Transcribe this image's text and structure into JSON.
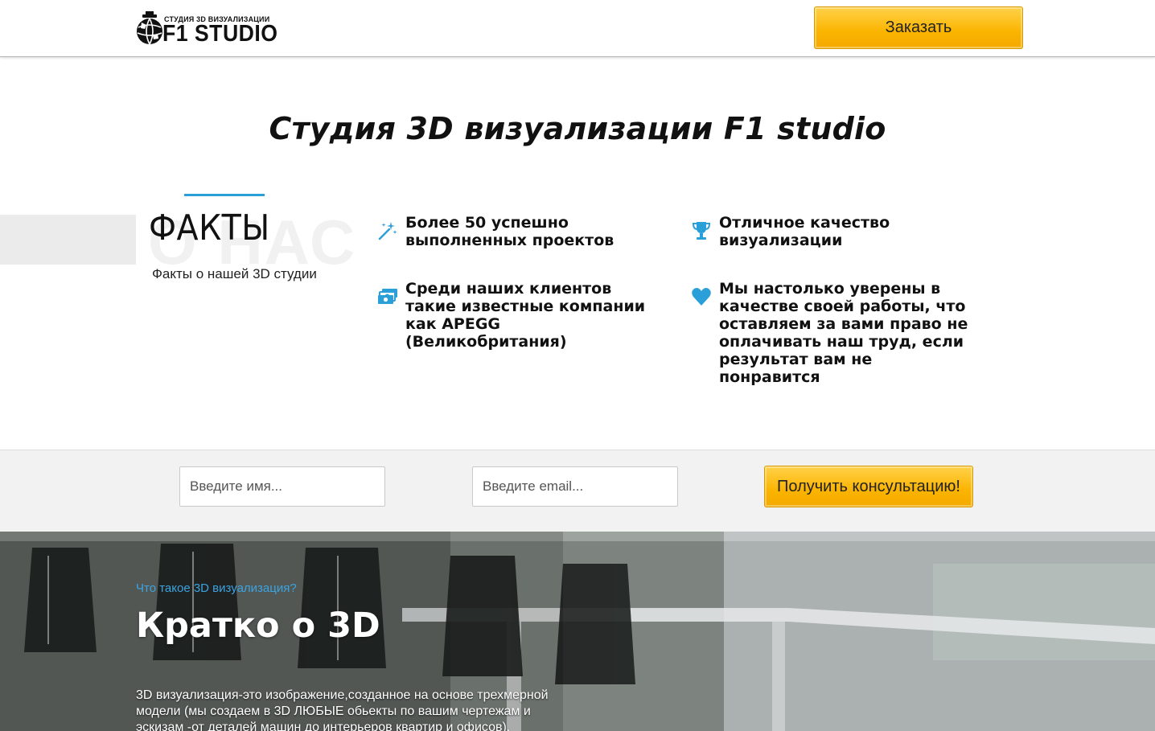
{
  "header": {
    "logo_subtitle": "СТУДИЯ 3D ВИЗУАЛИЗАЦИИ",
    "logo_title": "F1 STUDIO",
    "order_button": "Заказать"
  },
  "main": {
    "title": "Студия 3D визуализации F1 studio"
  },
  "facts": {
    "ghost_text": "О НАС",
    "heading": "ФАКТЫ",
    "subheading": "Факты о нашей 3D студии",
    "items": [
      {
        "icon": "magic-wand-icon",
        "text": "Более 50 успешно выполненных проектов"
      },
      {
        "icon": "trophy-icon",
        "text": "Отличное качество визуализации"
      },
      {
        "icon": "money-icon",
        "text": "Среди наших клиентов такие известные компании как APEGG (Великобритания)"
      },
      {
        "icon": "heart-icon",
        "text": "Мы настолько уверены в качестве своей работы, что оставляем за вами право не оплачивать наш труд, если результат вам не понравится"
      }
    ],
    "accent_color": "#2a9fd8"
  },
  "form": {
    "name_placeholder": "Введите имя...",
    "email_placeholder": "Введите email...",
    "submit_button": "Получить консультацию!"
  },
  "about": {
    "link": "Что такое 3D визуализация?",
    "title": "Кратко о 3D",
    "text": "3D визуализация-это изображение,созданное на основе трехмерной модели (мы создаем в 3D ЛЮБЫЕ обьекты по вашим чертежам и эскизам -от деталей машин до интерьеров квартир и офисов)."
  },
  "colors": {
    "button_yellow": "#fbb400",
    "link_blue": "#3ba3e0"
  }
}
